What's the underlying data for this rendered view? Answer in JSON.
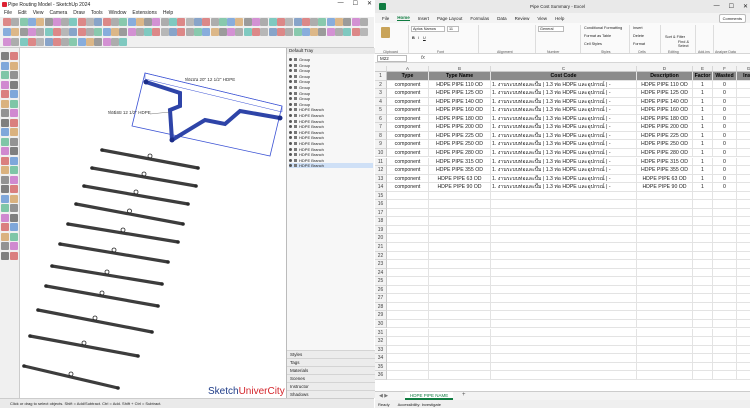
{
  "sketchup": {
    "title": "Pipe Routing Model - SketchUp 2024",
    "menu": [
      "File",
      "Edit",
      "View",
      "Camera",
      "Draw",
      "Tools",
      "Window",
      "Extensions",
      "Help"
    ],
    "tray_title": "Default Tray",
    "outliner": [
      "Group",
      "Group",
      "Group",
      "Group",
      "Group",
      "Group",
      "Group",
      "Group",
      "Group",
      "HDPE Branch",
      "HDPE Branch",
      "HDPE Branch",
      "HDPE Branch",
      "HDPE Branch",
      "HDPE Branch",
      "HDPE Branch",
      "HDPE Branch",
      "HDPE Branch",
      "HDPE Branch",
      "HDPE Branch"
    ],
    "panels": [
      "Styles",
      "Tags",
      "Materials",
      "Scenes",
      "Instructor",
      "Shadows"
    ],
    "labels": {
      "pipe_a": "ท่อเมน 20\" 12 1/2\" HDPE",
      "pipe_b": "ท่อย่อย 12 1/2\" HDPE"
    },
    "watermark": {
      "a": "Sketch",
      "b": "UniverCity"
    },
    "status": "Click or drag to select objects. Shift = Add/Subtract. Ctrl = Add. Shift + Ctrl = Subtract."
  },
  "excel": {
    "title": "Pipe Cost Summary - Excel",
    "tabs": [
      "File",
      "Home",
      "Insert",
      "Page Layout",
      "Formulas",
      "Data",
      "Review",
      "View",
      "Help"
    ],
    "active_tab": "Home",
    "comments": "Comments",
    "ribbon": {
      "font_name": "Aptos Narrow",
      "font_size": "11",
      "number_format": "General",
      "groups": [
        "Clipboard",
        "Font",
        "Alignment",
        "Number",
        "Styles",
        "Cells",
        "Editing",
        "Add-ins",
        "Analyze Data"
      ],
      "styles_items": [
        "Conditional Formatting",
        "Format as Table",
        "Cell Styles"
      ],
      "cells_items": [
        "Insert",
        "Delete",
        "Format"
      ],
      "editing_items": [
        "Sort & Filter",
        "Find & Select"
      ]
    },
    "name_box": "M22",
    "fx": "fx",
    "columns": [
      "A",
      "B",
      "C",
      "D",
      "E",
      "F",
      "G"
    ],
    "headers": [
      "Type",
      "Type Name",
      "Cost Code",
      "Description",
      "Factor",
      "Wasted",
      "Insp"
    ],
    "rows": [
      [
        "component",
        "HDPE PIPE 110 OD",
        "1. งานระบบท่อและปั๊ม | 1.3 ท่อ HDPE และอุปกรณ์ | -",
        "HDPE PIPE 110 OD",
        "1",
        "0"
      ],
      [
        "component",
        "HDPE PIPE 125 OD",
        "1. งานระบบท่อและปั๊ม | 1.3 ท่อ HDPE และอุปกรณ์ | -",
        "HDPE PIPE 125 OD",
        "1",
        "0"
      ],
      [
        "component",
        "HDPE PIPE 140 OD",
        "1. งานระบบท่อและปั๊ม | 1.3 ท่อ HDPE และอุปกรณ์ | -",
        "HDPE PIPE 140 OD",
        "1",
        "0"
      ],
      [
        "component",
        "HDPE PIPE 160 OD",
        "1. งานระบบท่อและปั๊ม | 1.3 ท่อ HDPE และอุปกรณ์ | -",
        "HDPE PIPE 160 OD",
        "1",
        "0"
      ],
      [
        "component",
        "HDPE PIPE 180 OD",
        "1. งานระบบท่อและปั๊ม | 1.3 ท่อ HDPE และอุปกรณ์ | -",
        "HDPE PIPE 180 OD",
        "1",
        "0"
      ],
      [
        "component",
        "HDPE PIPE 200 OD",
        "1. งานระบบท่อและปั๊ม | 1.3 ท่อ HDPE และอุปกรณ์ | -",
        "HDPE PIPE 200 OD",
        "1",
        "0"
      ],
      [
        "component",
        "HDPE PIPE 225 OD",
        "1. งานระบบท่อและปั๊ม | 1.3 ท่อ HDPE และอุปกรณ์ | -",
        "HDPE PIPE 225 OD",
        "1",
        "0"
      ],
      [
        "component",
        "HDPE PIPE 250 OD",
        "1. งานระบบท่อและปั๊ม | 1.3 ท่อ HDPE และอุปกรณ์ | -",
        "HDPE PIPE 250 OD",
        "1",
        "0"
      ],
      [
        "component",
        "HDPE PIPE 280 OD",
        "1. งานระบบท่อและปั๊ม | 1.3 ท่อ HDPE และอุปกรณ์ | -",
        "HDPE PIPE 280 OD",
        "1",
        "0"
      ],
      [
        "component",
        "HDPE PIPE 315 OD",
        "1. งานระบบท่อและปั๊ม | 1.3 ท่อ HDPE และอุปกรณ์ | -",
        "HDPE PIPE 315 OD",
        "1",
        "0"
      ],
      [
        "component",
        "HDPE PIPE 355 OD",
        "1. งานระบบท่อและปั๊ม | 1.3 ท่อ HDPE และอุปกรณ์ | -",
        "HDPE PIPE 355 OD",
        "1",
        "0"
      ],
      [
        "component",
        "HDPE PIPE 63 OD",
        "1. งานระบบท่อและปั๊ม | 1.3 ท่อ HDPE และอุปกรณ์ | -",
        "HDPE PIPE 63 OD",
        "1",
        "0"
      ],
      [
        "component",
        "HDPE PIPE 90 OD",
        "1. งานระบบท่อและปั๊ม | 1.3 ท่อ HDPE และอุปกรณ์ | -",
        "HDPE PIPE 90 OD",
        "1",
        "0"
      ]
    ],
    "row_count": 36,
    "sheet_tab": "HDPE PIPE NAME",
    "status_ready": "Ready",
    "status_access": "Accessibility: Investigate",
    "colors": {
      "accent": "#107c41",
      "header_fill": "#8b8b8b"
    }
  }
}
